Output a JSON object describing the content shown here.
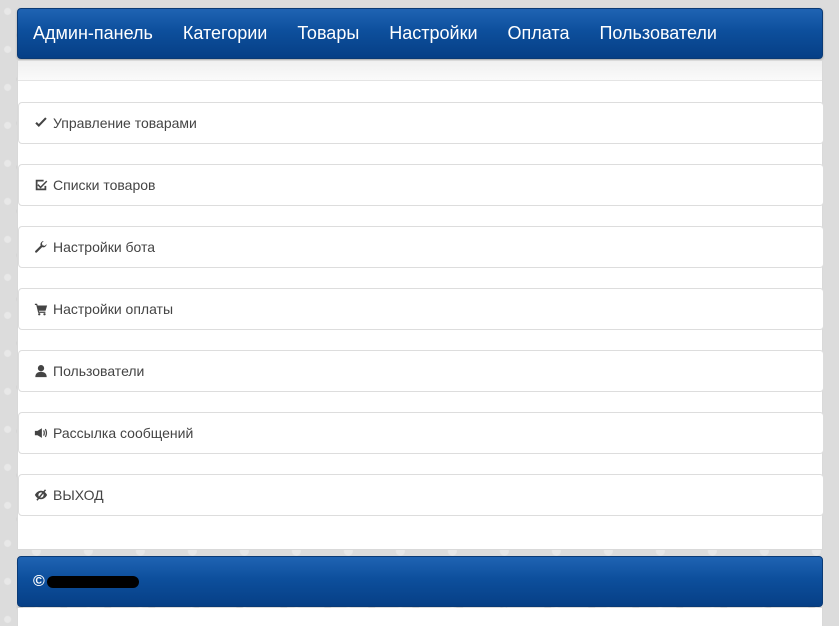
{
  "navbar": {
    "items": [
      "Админ-панель",
      "Категории",
      "Товары",
      "Настройки",
      "Оплата",
      "Пользователи"
    ]
  },
  "menu": [
    {
      "icon": "checkmark-icon",
      "label": "Управление товарами"
    },
    {
      "icon": "checkbox-icon",
      "label": "Списки товаров"
    },
    {
      "icon": "wrench-icon",
      "label": "Настройки бота"
    },
    {
      "icon": "cart-icon",
      "label": "Настройки оплаты"
    },
    {
      "icon": "user-icon",
      "label": "Пользователи"
    },
    {
      "icon": "megaphone-icon",
      "label": "Рассылка сообщений"
    },
    {
      "icon": "eye-slash-icon",
      "label": "ВЫХОД"
    }
  ],
  "footer": {
    "copyright_symbol": "©"
  },
  "colors": {
    "navbar": "#0d4f9c",
    "footer": "#0d4f9c",
    "text": "#444444"
  }
}
